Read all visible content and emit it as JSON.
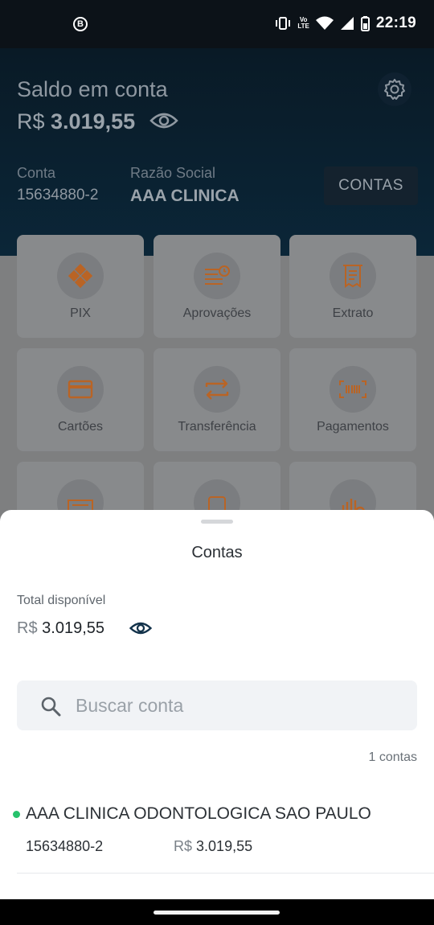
{
  "status_bar": {
    "left_icon_letter": "B",
    "lte_top": "Vo",
    "lte_bottom": "LTE",
    "time": "22:19",
    "icons": [
      "vibrate-icon",
      "volte-icon",
      "wifi-icon",
      "signal-icon",
      "battery-icon"
    ]
  },
  "header": {
    "saldo_label": "Saldo em conta",
    "saldo_currency": "R$",
    "saldo_value": "3.019,55",
    "conta_label": "Conta",
    "conta_value": "15634880-2",
    "razao_label": "Razão Social",
    "razao_value": "AAA CLINICA",
    "contas_button": "CONTAS"
  },
  "grid": {
    "items": [
      {
        "label": "PIX",
        "icon": "pix-icon"
      },
      {
        "label": "Aprovações",
        "icon": "approvals-icon"
      },
      {
        "label": "Extrato",
        "icon": "receipt-icon"
      },
      {
        "label": "Cartões",
        "icon": "card-icon"
      },
      {
        "label": "Transferência",
        "icon": "transfer-icon"
      },
      {
        "label": "Pagamentos",
        "icon": "barcode-icon"
      }
    ],
    "accent_color": "#c0651a"
  },
  "sheet": {
    "title": "Contas",
    "total_label": "Total disponível",
    "total_currency": "R$",
    "total_value": "3.019,55",
    "search_placeholder": "Buscar conta",
    "count_text": "1 contas",
    "accounts": [
      {
        "name": "AAA CLINICA ODONTOLOGICA SAO PAULO",
        "number": "15634880-2",
        "currency": "R$",
        "balance": "3.019,55",
        "status_color": "#27c26c"
      }
    ]
  }
}
